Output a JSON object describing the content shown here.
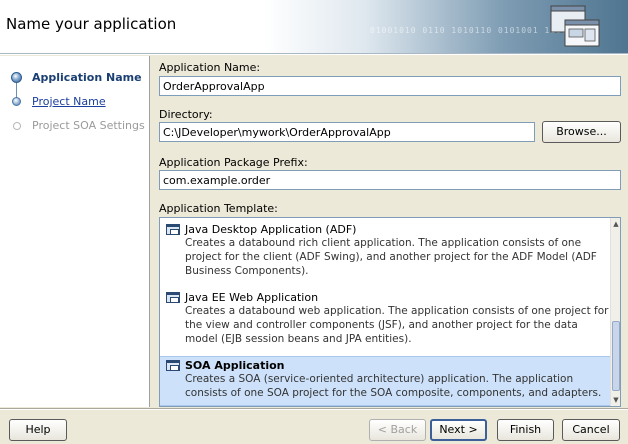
{
  "header": {
    "title": "Name your application",
    "pattern": "01001010 0110 1010110 0101001 1100"
  },
  "steps": [
    {
      "label": "Application Name",
      "state": "active"
    },
    {
      "label": "Project Name",
      "state": "link"
    },
    {
      "label": "Project SOA Settings",
      "state": "disabled"
    }
  ],
  "form": {
    "app_name_label": "Application Name:",
    "app_name_value": "OrderApprovalApp",
    "directory_label": "Directory:",
    "directory_value": "C:\\JDeveloper\\mywork\\OrderApprovalApp",
    "browse_label": "Browse...",
    "package_label": "Application Package Prefix:",
    "package_value": "com.example.order",
    "template_label": "Application Template:"
  },
  "templates": [
    {
      "title": "Java Desktop Application (ADF)",
      "desc": "Creates a databound rich client application. The application consists of one project for the client (ADF Swing), and another project for the ADF Model (ADF Business Components).",
      "selected": false
    },
    {
      "title": "Java EE Web Application",
      "desc": "Creates a databound web application. The application consists of one project for the view and controller components (JSF), and another project for the data model (EJB session beans and JPA entities).",
      "selected": false
    },
    {
      "title": "SOA Application",
      "desc": "Creates a SOA (service-oriented architecture) application. The application consists of one SOA project for the SOA composite, components, and adapters.",
      "selected": true
    }
  ],
  "buttons": {
    "help": "Help",
    "back": "< Back",
    "next": "Next >",
    "finish": "Finish",
    "cancel": "Cancel"
  },
  "colors": {
    "active_step": "#1a3f73",
    "selection": "#cde2fa",
    "input_border": "#7f9db9"
  }
}
